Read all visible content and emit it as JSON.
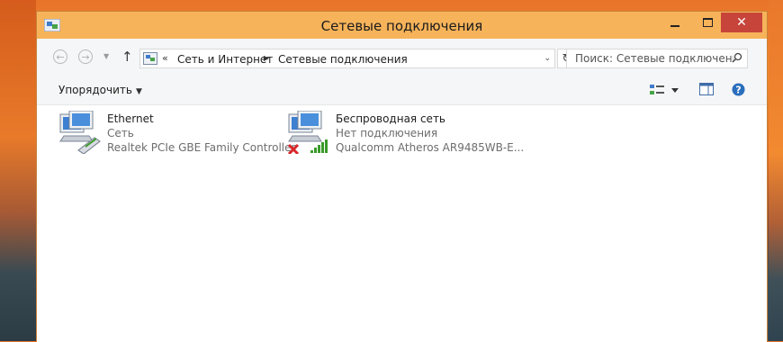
{
  "window": {
    "title": "Сетевые подключения",
    "controls": {
      "minimize": "minimize",
      "maximize": "maximize",
      "close": "✕"
    }
  },
  "navigation": {
    "back_icon": "arrow-left-icon",
    "forward_icon": "arrow-right-icon",
    "history_icon": "chevron-down-icon",
    "up_icon": "arrow-up-icon",
    "breadcrumb": {
      "overflow": "«",
      "segments": [
        "Сеть и Интернет",
        "Сетевые подключения"
      ]
    },
    "refresh_icon": "refresh-icon",
    "search_placeholder": "Поиск: Сетевые подключения"
  },
  "toolbar": {
    "organize_label": "Упорядочить",
    "view_icon": "change-view-icon",
    "preview_pane_icon": "preview-pane-icon",
    "help_icon": "help-icon"
  },
  "connections": [
    {
      "name": "Ethernet",
      "status": "Сеть",
      "device": "Realtek PCIe GBE Family Controller",
      "icon": "ethernet-adapter-icon"
    },
    {
      "name": "Беспроводная сеть",
      "status": "Нет подключения",
      "device": "Qualcomm Atheros AR9485WB-E...",
      "icon": "wireless-adapter-icon"
    }
  ],
  "colors": {
    "titlebar": "#f7b35a",
    "close_button": "#c7443a",
    "content_bg": "#ffffff",
    "secondary_text": "#6d6d6d",
    "help_blue": "#2a6ebd",
    "signal_green": "#3a9a2a",
    "error_red": "#d8262a"
  }
}
